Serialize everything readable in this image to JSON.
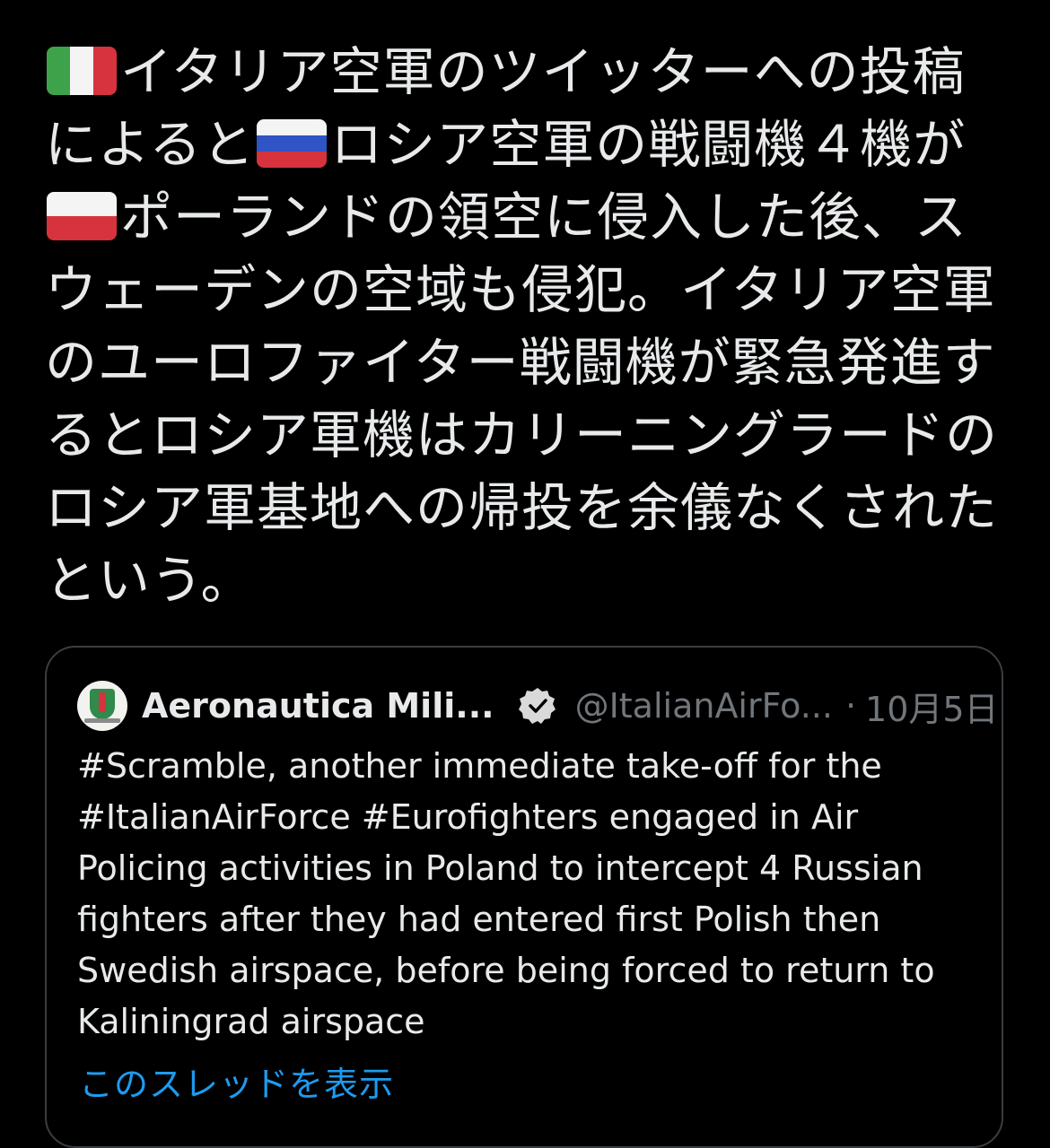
{
  "tweet": {
    "segments": [
      {
        "type": "flag",
        "flag": "italy-flag"
      },
      {
        "type": "text",
        "text": "イタリア空軍のツイッターへの投稿によると"
      },
      {
        "type": "flag",
        "flag": "russia-flag"
      },
      {
        "type": "text",
        "text": "ロシア空軍の戦闘機４機が"
      },
      {
        "type": "flag",
        "flag": "poland-flag"
      },
      {
        "type": "text",
        "text": "ポーランドの領空に侵入した後、スウェーデンの空域も侵犯。イタリア空軍のユーロファイター戦闘機が緊急発進するとロシア軍機はカリーニングラードのロシア軍基地への帰投を余儀なくされたという。"
      }
    ]
  },
  "quote": {
    "name": "Aeronautica Mili...",
    "handle": "@ItalianAirFo...",
    "separator": "·",
    "date": "10月5日",
    "verified_icon": "verified-badge-icon",
    "avatar_icon": "air-force-crest-icon",
    "body": "#Scramble, another immediate take-off for the #ItalianAirForce #Eurofighters engaged in Air Policing activities in Poland to intercept 4 Russian fighters after they had entered first Polish then Swedish airspace, before being forced to return to Kaliningrad airspace",
    "show_thread": "このスレッドを表示"
  },
  "colors": {
    "background": "#000000",
    "text": "#e7e9ea",
    "secondary_text": "#71767b",
    "link": "#1d9bf0",
    "card_border": "#3a3d41"
  }
}
